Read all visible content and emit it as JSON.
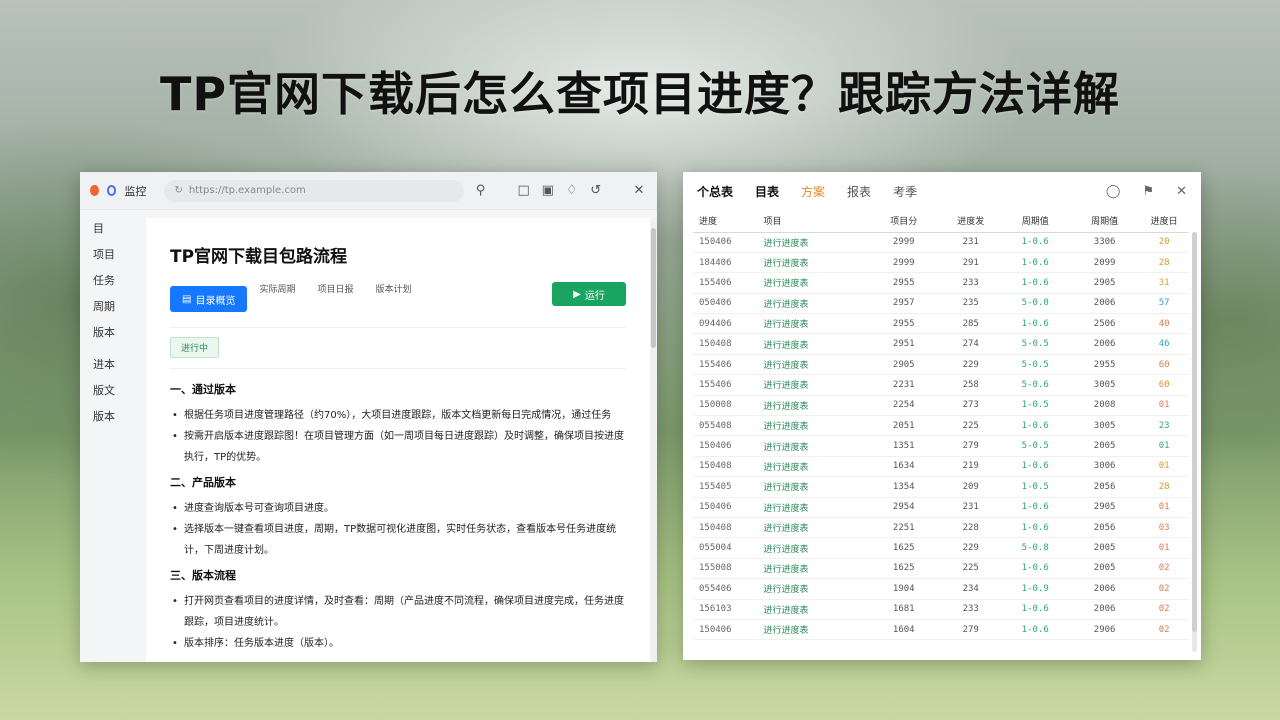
{
  "headline": "TP官网下载后怎么查项目进度？跟踪方法详解",
  "left_window": {
    "tab_title": "监控",
    "address": "https://tp.example.com",
    "sidebar": [
      "目",
      "项目",
      "任务",
      "周期",
      "版本",
      "进本",
      "版文",
      "版本"
    ],
    "doc_title": "TP官网下载目包路流程",
    "primary_button": "目录概览",
    "meta": [
      "实际周期",
      "项目日报",
      "版本计划"
    ],
    "run_button": "运行",
    "tag": "进行中",
    "sections": [
      {
        "heading": "一、通过版本",
        "items": [
          "根据任务项目进度管理路径（约70%），大项目进度跟踪，版本文档更新每日完成情况，通过任务",
          "按需开启版本进度跟踪图！在项目管理方面（如一周项目每日进度跟踪）及时调整，确保项目按进度执行，TP的优势。"
        ]
      },
      {
        "heading": "二、产品版本",
        "items": [
          "进度查询版本号可查询项目进度。",
          "选择版本一键查看项目进度，周期，TP数据可视化进度图，实时任务状态，查看版本号任务进度统计，下周进度计划。"
        ]
      },
      {
        "heading": "三、版本流程",
        "items": [
          "打开网页查看项目的进度详情，及时查看：周期（产品进度不同流程，确保项目进度完成，任务进度跟踪，项目进度统计。",
          "版本排序：任务版本进度（版本）。"
        ]
      }
    ]
  },
  "right_window": {
    "tabs": [
      "个总表",
      "目表",
      "方案",
      "报表",
      "考季"
    ],
    "icons": [
      "circle-icon",
      "pin-icon",
      "close-icon"
    ],
    "columns": [
      "进度",
      "项目",
      "项目分",
      "进度发",
      "周期值",
      "周期值",
      "进度日"
    ],
    "rows": [
      [
        "150406",
        "进行进度表",
        "2999",
        "231",
        "1-0.6",
        "3306",
        "20"
      ],
      [
        "184406",
        "进行进度表",
        "2999",
        "291",
        "1-0.6",
        "2099",
        "28"
      ],
      [
        "155406",
        "进行进度表",
        "2955",
        "233",
        "1-0.6",
        "2905",
        "31"
      ],
      [
        "050406",
        "进行进度表",
        "2957",
        "235",
        "5-0.0",
        "2006",
        "57"
      ],
      [
        "094406",
        "进行进度表",
        "2955",
        "285",
        "1-0.6",
        "2506",
        "40"
      ],
      [
        "150408",
        "进行进度表",
        "2951",
        "274",
        "5-0.5",
        "2006",
        "46"
      ],
      [
        "155406",
        "进行进度表",
        "2905",
        "229",
        "5-0.5",
        "2955",
        "60"
      ],
      [
        "155406",
        "进行进度表",
        "2231",
        "258",
        "5-0.6",
        "3005",
        "60"
      ],
      [
        "150008",
        "进行进度表",
        "2254",
        "273",
        "1-0.5",
        "2008",
        "01"
      ],
      [
        "055408",
        "进行进度表",
        "2051",
        "225",
        "1-0.6",
        "3005",
        "23"
      ],
      [
        "150406",
        "进行进度表",
        "1351",
        "279",
        "5-0.5",
        "2005",
        "01"
      ],
      [
        "150408",
        "进行进度表",
        "1634",
        "219",
        "1-0.6",
        "3006",
        "01"
      ],
      [
        "155405",
        "进行进度表",
        "1354",
        "209",
        "1-0.5",
        "2056",
        "28"
      ],
      [
        "150406",
        "进行进度表",
        "2954",
        "231",
        "1-0.6",
        "2905",
        "01"
      ],
      [
        "150408",
        "进行进度表",
        "2251",
        "228",
        "1-0.6",
        "2056",
        "03"
      ],
      [
        "055004",
        "进行进度表",
        "1625",
        "229",
        "5-0.8",
        "2005",
        "01"
      ],
      [
        "155008",
        "进行进度表",
        "1625",
        "225",
        "1-0.6",
        "2005",
        "02"
      ],
      [
        "055406",
        "进行进度表",
        "1904",
        "234",
        "1-0.9",
        "2006",
        "02"
      ],
      [
        "156103",
        "进行进度表",
        "1681",
        "233",
        "1-0.6",
        "2006",
        "02"
      ],
      [
        "150406",
        "进行进度表",
        "1604",
        "279",
        "1-0.6",
        "2906",
        "02"
      ]
    ],
    "last_col_colors": [
      "#e0962c",
      "#e0962c",
      "#d9a12c",
      "#3b9fd8",
      "#e07a4e",
      "#3b9fd8",
      "#e07a4e",
      "#e0962c",
      "#e07a4e",
      "#2eaa6e",
      "#2eaa6e",
      "#e0962c",
      "#e0962c",
      "#e07a4e",
      "#e07a4e",
      "#e07a4e",
      "#e07a4e",
      "#e07a4e",
      "#e07a4e",
      "#e07a4e"
    ]
  }
}
